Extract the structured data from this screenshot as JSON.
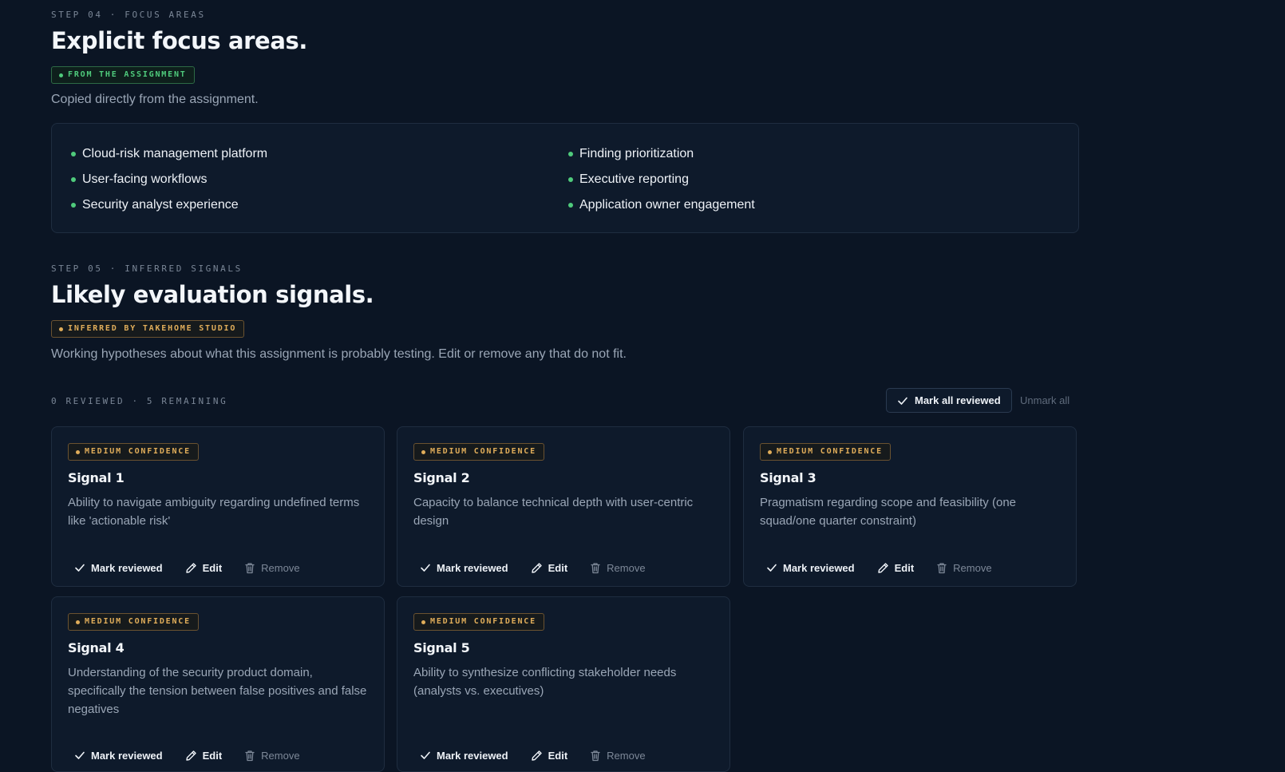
{
  "focus": {
    "eyebrow": "STEP 04 · FOCUS AREAS",
    "title": "Explicit focus areas.",
    "badge": "FROM THE ASSIGNMENT",
    "lede": "Copied directly from the assignment.",
    "items_left": [
      "Cloud-risk management platform",
      "User-facing workflows",
      "Security analyst experience"
    ],
    "items_right": [
      "Finding prioritization",
      "Executive reporting",
      "Application owner engagement"
    ]
  },
  "signals": {
    "eyebrow": "STEP 05 · INFERRED SIGNALS",
    "title": "Likely evaluation signals.",
    "badge": "INFERRED BY TAKEHOME STUDIO",
    "lede": "Working hypotheses about what this assignment is probably testing. Edit or remove any that do not fit.",
    "counter": "0 REVIEWED · 5 REMAINING",
    "mark_all_label": "Mark all reviewed",
    "unmark_all_label": "Unmark all",
    "actions": {
      "review": "Mark reviewed",
      "edit": "Edit",
      "remove": "Remove"
    },
    "cards": [
      {
        "confidence": "MEDIUM CONFIDENCE",
        "title": "Signal 1",
        "desc": "Ability to navigate ambiguity regarding undefined terms like 'actionable risk'"
      },
      {
        "confidence": "MEDIUM CONFIDENCE",
        "title": "Signal 2",
        "desc": "Capacity to balance technical depth with user-centric design"
      },
      {
        "confidence": "MEDIUM CONFIDENCE",
        "title": "Signal 3",
        "desc": "Pragmatism regarding scope and feasibility (one squad/one quarter constraint)"
      },
      {
        "confidence": "MEDIUM CONFIDENCE",
        "title": "Signal 4",
        "desc": "Understanding of the security product domain, specifically the tension between false positives and false negatives"
      },
      {
        "confidence": "MEDIUM CONFIDENCE",
        "title": "Signal 5",
        "desc": "Ability to synthesize conflicting stakeholder needs (analysts vs. executives)"
      }
    ]
  },
  "colors": {
    "background": "#0b1524",
    "green": "#4fcb7c",
    "amber": "#e0ad5a"
  }
}
